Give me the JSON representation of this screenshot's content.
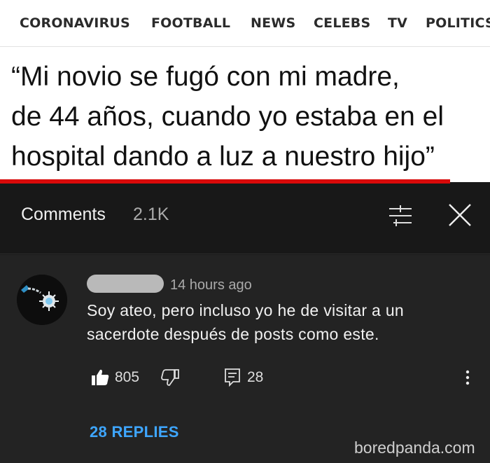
{
  "nav": {
    "items": [
      "CORONAVIRUS",
      "FOOTBALL",
      "NEWS",
      "CELEBS",
      "TV",
      "POLITICS"
    ]
  },
  "headline": {
    "lines": [
      "“Mi novio se fugó con mi madre,",
      "de 44 años, cuando yo estaba en el",
      "hospital dando a luz a nuestro hijo”"
    ]
  },
  "comments": {
    "title": "Comments",
    "count": "2.1K",
    "icons": {
      "filter": "sort-filter-icon",
      "close": "close-icon"
    }
  },
  "comment": {
    "timestamp": "14 hours ago",
    "text_lines": [
      "Soy ateo, pero incluso yo he de visitar a  un",
      "sacerdote después de posts como este."
    ],
    "likes": "805",
    "replies_count": "28",
    "replies_link": "28 REPLIES",
    "icons": {
      "like": "thumbs-up-icon",
      "dislike": "thumbs-down-icon",
      "reply": "reply-icon",
      "more": "more-vertical-icon"
    }
  },
  "watermark": "boredpanda.com",
  "colors": {
    "accent_red": "#d80a0a",
    "link_blue": "#3ea6ff",
    "panel_bg": "#181818",
    "comment_bg": "#232323"
  }
}
